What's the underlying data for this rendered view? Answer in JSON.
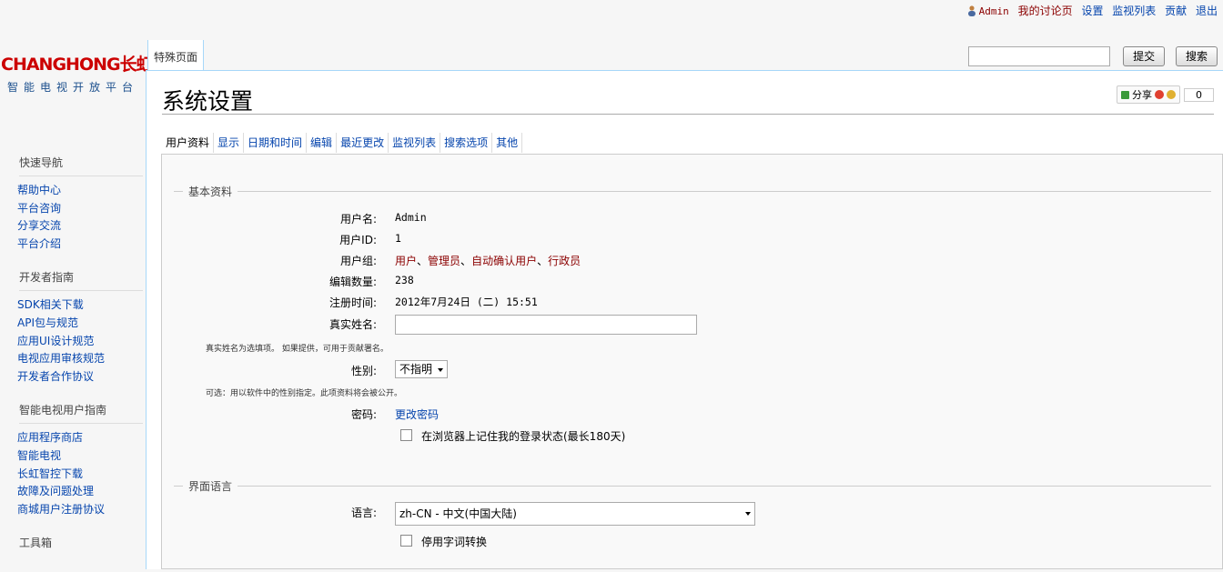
{
  "personal": {
    "user": "Admin",
    "links": [
      "我的讨论页",
      "设置",
      "监视列表",
      "贡献",
      "退出"
    ]
  },
  "logo": {
    "main": "CHANGHONG长虹",
    "sub": "智能电视开放平台"
  },
  "top_tab": "特殊页面",
  "search": {
    "submit_label": "提交",
    "search_label": "搜索",
    "value": ""
  },
  "page_title": "系统设置",
  "share": {
    "label": "分享",
    "count": "0"
  },
  "sidebar": [
    {
      "heading": "快速导航",
      "items": [
        "帮助中心",
        "平台咨询",
        "分享交流",
        "平台介绍"
      ]
    },
    {
      "heading": "开发者指南",
      "items": [
        "SDK相关下载",
        "API包与规范",
        "应用UI设计规范",
        "电视应用审核规范",
        "开发者合作协议"
      ]
    },
    {
      "heading": "智能电视用户指南",
      "items": [
        "应用程序商店",
        "智能电视",
        "长虹智控下载",
        "故障及问题处理",
        "商城用户注册协议"
      ]
    },
    {
      "heading": "工具箱",
      "items": []
    }
  ],
  "pref_tabs": [
    "用户资料",
    "显示",
    "日期和时间",
    "编辑",
    "最近更改",
    "监视列表",
    "搜索选项",
    "其他"
  ],
  "basic": {
    "legend": "基本资料",
    "username_label": "用户名:",
    "username": "Admin",
    "userid_label": "用户ID:",
    "userid": "1",
    "groups_label": "用户组:",
    "groups": [
      "用户",
      "管理员",
      "自动确认用户",
      "行政员"
    ],
    "groups_sep": "、",
    "edits_label": "编辑数量:",
    "edits": "238",
    "reg_label": "注册时间:",
    "reg": "2012年7月24日 (二) 15:51",
    "realname_label": "真实姓名:",
    "realname_value": "",
    "realname_help": "真实姓名为选填项。 如果提供，可用于贡献署名。",
    "gender_label": "性别:",
    "gender_value": "不指明",
    "gender_help": "可选：用以软件中的性别指定。此项资料将会被公开。",
    "password_label": "密码:",
    "password_link": "更改密码",
    "remember_label": "在浏览器上记住我的登录状态(最长180天)"
  },
  "language": {
    "legend": "界面语言",
    "label": "语言:",
    "value": "zh-CN - 中文(中国大陆)",
    "disable_conv_label": "停用字词转换"
  },
  "colors": {
    "link": "#0645ad",
    "red_link": "#8b0000",
    "brand": "#cc0000",
    "border": "#a7d7f9"
  }
}
